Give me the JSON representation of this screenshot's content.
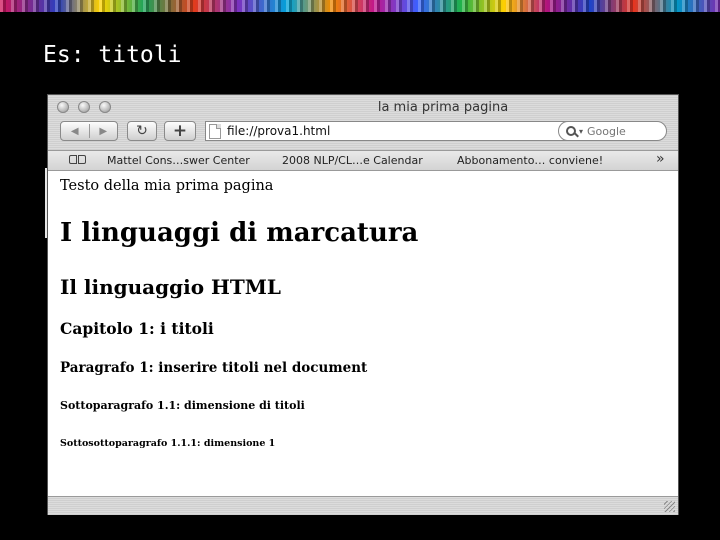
{
  "slide": {
    "title": "Es: titoli"
  },
  "browser": {
    "window_title": "la mia prima pagina",
    "toolbar": {
      "back_icon": "◀",
      "forward_icon": "▶",
      "reload_icon": "↻",
      "add_icon": "+"
    },
    "address": {
      "value": "file://prova1.html"
    },
    "search": {
      "placeholder": "Google"
    },
    "bookmarks": [
      {
        "label": "Mattel Cons…swer Center"
      },
      {
        "label": "2008 NLP/CL…e Calendar"
      },
      {
        "label": "Abbonamento… conviene!"
      }
    ],
    "more_label": "»"
  },
  "page": {
    "paragraph": "Testo della mia prima pagina",
    "h1": "I linguaggi di marcatura",
    "h2": "Il linguaggio HTML",
    "h3": "Capitolo 1: i titoli",
    "h4": "Paragrafo 1: inserire titoli nel document",
    "h5": "Sottoparagrafo 1.1: dimensione di titoli",
    "h6": "Sottosottoparagrafo 1.1.1: dimensione 1"
  }
}
